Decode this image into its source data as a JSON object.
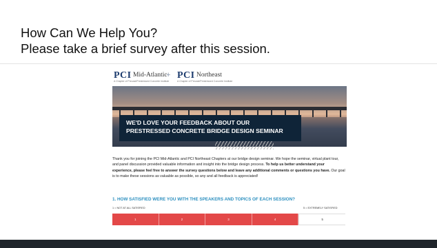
{
  "slide": {
    "title_line1": "How Can We Help You?",
    "title_line2": "Please take a brief survey after this session."
  },
  "logos": {
    "left_brand": "PCI",
    "left_chapter": "Mid-Atlantic",
    "left_tagline": "A Chapter of Precast/Prestressed Concrete Institute",
    "plus": "+",
    "right_brand": "PCI",
    "right_chapter": "Northeast",
    "right_tagline": "A Chapter of Precast/Prestressed Concrete Institute"
  },
  "hero": {
    "headline_line1": "WE'D LOVE YOUR FEEDBACK ABOUT OUR",
    "headline_line2": "PRESTRESSED CONCRETE BRIDGE DESIGN SEMINAR"
  },
  "intro": {
    "text_a": "Thank you for joining the PCI Mid-Atlantic and PCI Northeast Chapters at our bridge design seminar. We hope the seminar, virtual plant tour, and panel discussion provided valuable information and insight into the bridge design process. ",
    "text_bold": "To help us better understand your experience, please feel free to answer the survey questions below and leave any additional comments or questions you have.",
    "text_b": " Our goal is to make these sessions as valuable as possible, so any and all feedback is appreciated!"
  },
  "survey": {
    "question_1": "1. HOW SATISFIED WERE YOU WITH THE SPEAKERS AND TOPICS OF EACH SESSION?",
    "scale_min_label": "1 = NOT AT ALL SATISFIED",
    "scale_max_label": "5 = EXTREMELY SATISFIED",
    "ratings": [
      "1",
      "2",
      "3",
      "4",
      "5"
    ]
  },
  "colors": {
    "accent_red": "#e34848",
    "accent_blue": "#2c8fbf",
    "navy": "#0f2438"
  }
}
